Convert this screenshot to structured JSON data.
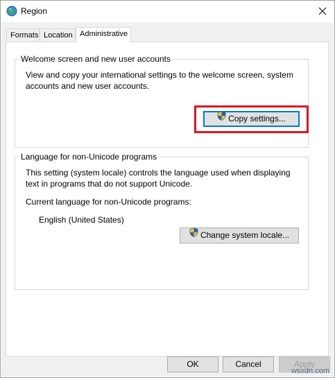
{
  "window": {
    "title": "Region"
  },
  "tabs": [
    "Formats",
    "Location",
    "Administrative"
  ],
  "welcome": {
    "heading": "Welcome screen and new user accounts",
    "description_line1": "View and copy your international settings to the welcome screen, system",
    "description_line2": "accounts and new user accounts.",
    "copy_button": "Copy settings..."
  },
  "non_unicode": {
    "heading": "Language for non-Unicode programs",
    "description_line1": "This setting (system locale) controls the language used when displaying",
    "description_line2": "text in programs that do not support Unicode.",
    "current_label": "Current language for non-Unicode programs:",
    "current_value": "English (United States)",
    "change_button": "Change system locale..."
  },
  "footer": {
    "ok": "OK",
    "cancel": "Cancel",
    "apply": "Apply"
  },
  "watermark": "wsxdn.com",
  "colors": {
    "highlight": "#e1131e",
    "focus": "#0078d7"
  },
  "icons": [
    "globe-icon",
    "close-icon",
    "uac-shield-icon"
  ]
}
